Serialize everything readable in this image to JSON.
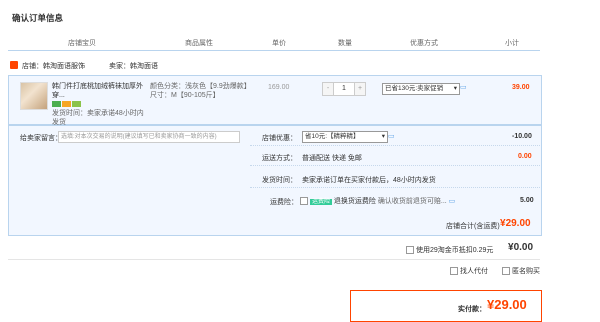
{
  "page_title": "确认订单信息",
  "columns": [
    "店铺宝贝",
    "商品属性",
    "单价",
    "数量",
    "优惠方式",
    "小计"
  ],
  "shop": {
    "label": "店铺：",
    "name": "韩淘面语服饰",
    "seller_label": "卖家：",
    "seller": "韩淘面语"
  },
  "item": {
    "name": "韩门件打底桃加绒裤袜加厚外穿...",
    "shipping_label": "发货时间：",
    "shipping": "卖家承诺48小时内发货",
    "attr_color": "颜色分类：浅灰色【9.9劲爆款】",
    "attr_size": "尺寸：M【90-105斤】",
    "price": "169.00",
    "qty_minus": "-",
    "qty": "1",
    "qty_plus": "+",
    "promo": "已省130元:卖家促销",
    "subtotal": "39.00"
  },
  "message": {
    "label": "给卖家留言：",
    "placeholder": "选填:对本次交易的说明(建议填写已和卖家协商一致的内容)"
  },
  "shop_promo": {
    "label": "店铺优惠：",
    "value": "省10元:【精粹精】",
    "amount": "-10.00"
  },
  "delivery": {
    "label": "运送方式：",
    "value": "普通配送 快递 免邮",
    "amount": "0.00"
  },
  "ship_time": {
    "label": "发货时间：",
    "value": "卖家承诺订单在买家付款后，48小时内发货"
  },
  "insurance": {
    "label": "运费险：",
    "tag": "运费险",
    "value": "退换货运费险",
    "extra": "确认收货前退货可赔...",
    "amount": "5.00"
  },
  "shop_total": {
    "label": "店铺合计(含运费)",
    "currency": "¥",
    "amount": "29.00"
  },
  "coins": {
    "label": "使用29淘金币抵扣0.29元",
    "currency": "¥",
    "amount": "0.00"
  },
  "options": {
    "proxy": "找人代付",
    "anonymous": "匿名购买"
  },
  "pay": {
    "label": "实付款：",
    "currency": "¥",
    "amount": "29.00"
  },
  "colors": {
    "accent": "#ff4400",
    "border": "#b9d4ee",
    "bg": "#f2f7ff"
  }
}
